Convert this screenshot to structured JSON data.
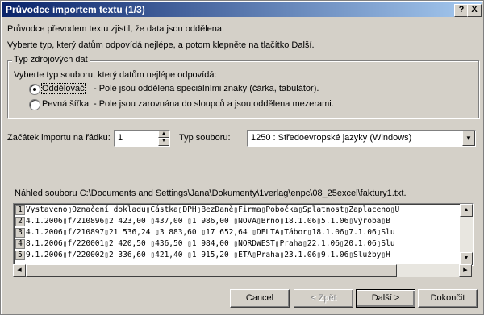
{
  "title": "Průvodce importem textu (1/3)",
  "titlebar_buttons": {
    "help": "?",
    "close": "X"
  },
  "intro_line1": "Průvodce převodem textu zjistil, že data jsou oddělena.",
  "intro_line2": "Vyberte typ, který datům odpovídá nejlépe, a potom klepněte na tlačítko Další.",
  "group": {
    "label": "Typ zdrojových dat",
    "prompt": "Vyberte typ souboru, který datům nejlépe odpovídá:",
    "options": [
      {
        "label": "Oddělovač",
        "desc": "- Pole jsou oddělena speciálními znaky (čárka, tabulátor).",
        "selected": true
      },
      {
        "label": "Pevná šířka",
        "desc": "- Pole jsou zarovnána do sloupců a jsou oddělena mezerami.",
        "selected": false
      }
    ]
  },
  "start_row": {
    "label": "Začátek importu na řádku:",
    "value": "1"
  },
  "file_type": {
    "label": "Typ souboru:",
    "value": "1250 : Středoevropské jazyky (Windows)"
  },
  "preview": {
    "label": "Náhled souboru C:\\Documents and Settings\\Jana\\Dokumenty\\1verlag\\enpc\\08_25excel\\faktury1.txt.",
    "rows": [
      {
        "n": "1",
        "text": "Vystaveno▯Označení dokladu▯Částka▯DPH▯BezDaně▯Firma▯Pobočka▯Splatnost▯Zaplaceno▯Ú"
      },
      {
        "n": "2",
        "text": "4.1.2006▯f/210896▯2 423,00 ▯437,00 ▯1 986,00 ▯NOVA▯Brno▯18.1.06▯5.1.06▯Výroba▯B"
      },
      {
        "n": "3",
        "text": "4.1.2006▯f/210897▯21 536,24 ▯3 883,60 ▯17 652,64 ▯DELTA▯Tábor▯18.1.06▯7.1.06▯Slu"
      },
      {
        "n": "4",
        "text": "8.1.2006▯f/220001▯2 420,50 ▯436,50 ▯1 984,00 ▯NORDWEST▯Praha▯22.1.06▯20.1.06▯Slu"
      },
      {
        "n": "5",
        "text": "9.1.2006▯f/220002▯2 336,60 ▯421,40 ▯1 915,20 ▯ETA▯Praha▯23.1.06▯9.1.06▯Služby▯H"
      }
    ]
  },
  "buttons": {
    "cancel": "Cancel",
    "back": "< Zpět",
    "next": "Další >",
    "finish": "Dokončit"
  }
}
